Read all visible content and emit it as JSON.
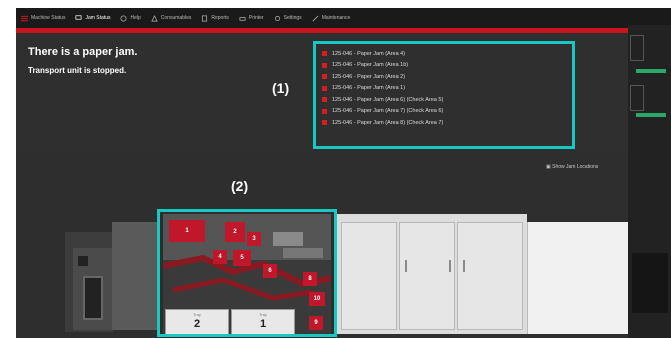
{
  "toolbar": {
    "items": [
      {
        "label": "Machine Status",
        "icon": "menu-icon"
      },
      {
        "label": "Jam Status",
        "icon": "printer-icon"
      },
      {
        "label": "Help",
        "icon": "help-icon"
      },
      {
        "label": "Consumables",
        "icon": "consumables-icon"
      },
      {
        "label": "Reports",
        "icon": "reports-icon"
      },
      {
        "label": "Printer",
        "icon": "printer-icon"
      },
      {
        "label": "Settings",
        "icon": "settings-icon"
      },
      {
        "label": "Maintenance",
        "icon": "maintenance-icon"
      }
    ],
    "accent": "#c8141e"
  },
  "message": {
    "title": "There is a paper jam.",
    "subtitle": "Transport unit is stopped."
  },
  "errors": [
    {
      "text": "125-046 - Paper Jam (Area 4)"
    },
    {
      "text": "125-046 - Paper Jam (Area 1b)"
    },
    {
      "text": "125-046 - Paper Jam (Area 2)"
    },
    {
      "text": "125-046 - Paper Jam (Area 1)"
    },
    {
      "text": "125-046 - Paper Jam (Area 6) (Check Area 5)"
    },
    {
      "text": "125-046 - Paper Jam (Area 7) (Check Area 6)"
    },
    {
      "text": "125-046 - Paper Jam (Area 8) (Check Area 7)"
    }
  ],
  "callouts": {
    "one": "(1)",
    "two": "(2)"
  },
  "link": {
    "label": "Show Jam Locations"
  },
  "jam_areas": {
    "a1": "1",
    "a2": "2",
    "a3": "3",
    "a4": "4",
    "a5": "5",
    "a6": "6",
    "a8": "8",
    "a10": "10",
    "a9": "9"
  },
  "drawers": [
    {
      "label": "Tray",
      "number": "2"
    },
    {
      "label": "Tray",
      "number": "1"
    }
  ],
  "colors": {
    "highlight": "#19c8c3",
    "error": "#d81c24"
  }
}
